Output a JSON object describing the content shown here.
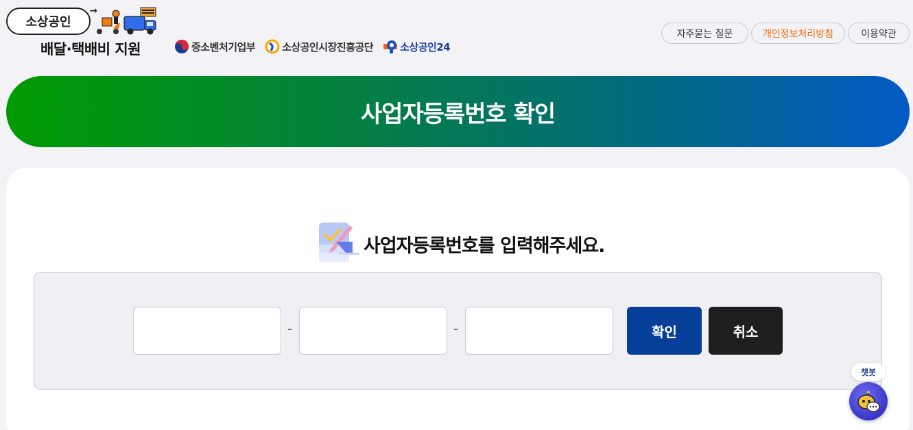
{
  "header": {
    "logo": {
      "pill_text": "소상공인",
      "subtitle": "배달·택배비 지원"
    },
    "partner_logos": [
      {
        "name": "중소벤처기업부",
        "icon": "taeguk-icon"
      },
      {
        "name": "소상공인시장진흥공단",
        "icon": "semic-logo-icon"
      },
      {
        "name": "소상공인24",
        "icon": "s24-logo-icon"
      }
    ],
    "links": {
      "faq": "자주묻는 질문",
      "privacy": "개인정보처리방침",
      "terms": "이용약관"
    }
  },
  "banner": {
    "title": "사업자등록번호 확인"
  },
  "form": {
    "instruction": "사업자등록번호를 입력해주세요.",
    "instruction_icon": "pencil-note-icon",
    "separator": "-",
    "fields": [
      {
        "value": "",
        "placeholder": ""
      },
      {
        "value": "",
        "placeholder": ""
      },
      {
        "value": "",
        "placeholder": ""
      }
    ],
    "confirm_label": "확인",
    "cancel_label": "취소"
  },
  "chatbot": {
    "label": "챗봇",
    "icon": "chatbot-icon"
  },
  "colors": {
    "banner_start": "#009a00",
    "banner_end": "#0459c4",
    "confirm_button": "#063e99",
    "cancel_button": "#1e1e1e",
    "privacy_link": "#f26a00"
  }
}
